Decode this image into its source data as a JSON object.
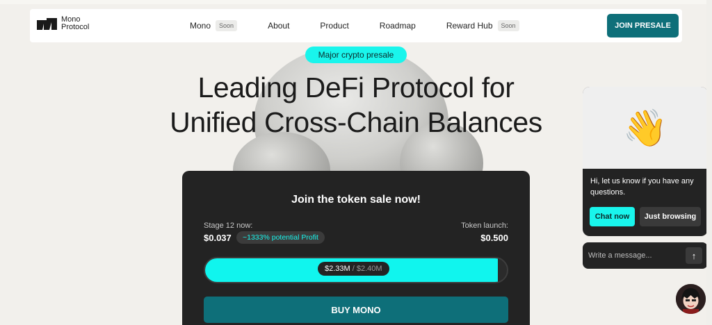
{
  "nav": {
    "logo_line1": "Mono",
    "logo_line2": "Protocol",
    "items": [
      {
        "label": "Mono",
        "badge": "Soon"
      },
      {
        "label": "About",
        "badge": ""
      },
      {
        "label": "Product",
        "badge": ""
      },
      {
        "label": "Roadmap",
        "badge": ""
      },
      {
        "label": "Reward Hub",
        "badge": "Soon"
      }
    ],
    "cta": "JOIN PRESALE"
  },
  "hero": {
    "pill": "Major crypto presale",
    "headline_line1": "Leading DeFi Protocol for",
    "headline_line2": "Unified Cross-Chain Balances"
  },
  "sale": {
    "title": "Join the token sale now!",
    "stage_label": "Stage 12 now:",
    "stage_price": "$0.037",
    "profit": "~1333% potential Profit",
    "launch_label": "Token launch:",
    "launch_price": "$0.500",
    "raised": "$2.33M",
    "separator": " / ",
    "goal": "$2.40M",
    "progress_fraction": 0.97,
    "buy_label": "BUY MONO"
  },
  "chat": {
    "emoji": "👋",
    "message": "Hi, let us know if you have any questions.",
    "chat_now": "Chat now",
    "just_browsing": "Just browsing",
    "input_placeholder": "Write a message...",
    "send_icon": "↑"
  },
  "colors": {
    "accent_teal": "#0e6f79",
    "accent_cyan": "#19f5ec",
    "card_dark": "#232323",
    "page_bg": "#f2f0ec"
  }
}
